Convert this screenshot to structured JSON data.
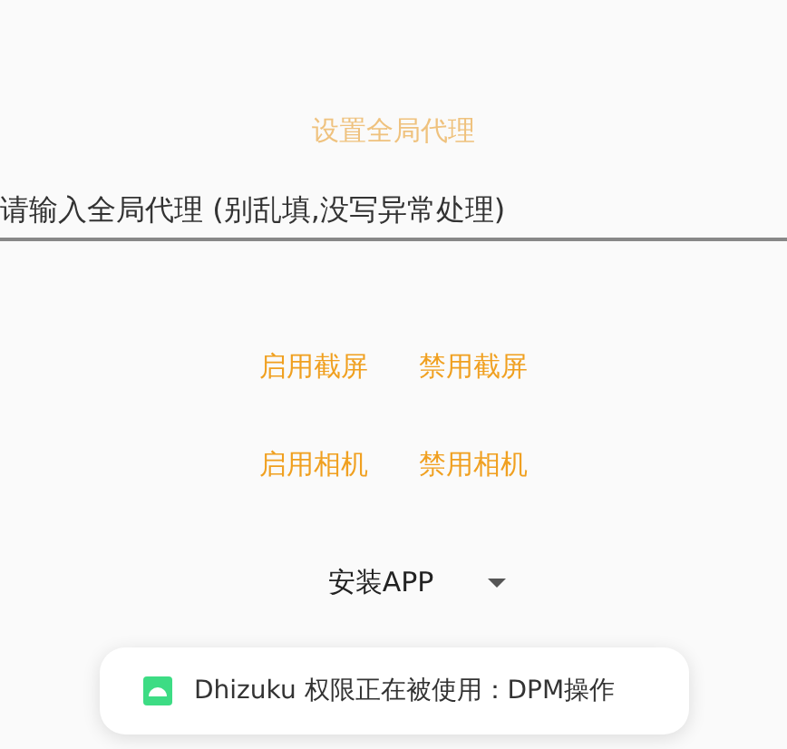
{
  "proxy_button": {
    "label": "设置全局代理",
    "disabled": true
  },
  "proxy_field": {
    "placeholder": "请输入全局代理 (别乱填,没写异常处理)"
  },
  "actions": [
    {
      "label": "启用截屏",
      "disabled": false
    },
    {
      "label": "禁用截屏",
      "disabled": false
    },
    {
      "label": "启用相机",
      "disabled": false
    },
    {
      "label": "禁用相机",
      "disabled": false
    }
  ],
  "dropdown": {
    "value": "安装APP"
  },
  "toast": {
    "text": "Dhizuku 权限正在被使用：DPM操作"
  }
}
